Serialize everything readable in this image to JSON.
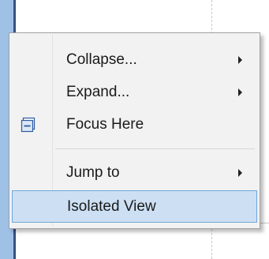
{
  "context_menu": {
    "items": [
      {
        "label": "Collapse...",
        "has_submenu": true,
        "icon": ""
      },
      {
        "label": "Expand...",
        "has_submenu": true,
        "icon": ""
      },
      {
        "label": "Focus Here",
        "has_submenu": false,
        "icon": "focus-frame-icon"
      },
      {
        "label": "Jump to",
        "has_submenu": true,
        "icon": ""
      },
      {
        "label": "Isolated View",
        "has_submenu": false,
        "icon": "",
        "highlighted": true
      }
    ]
  },
  "colors": {
    "menu_background": "#f2f2f2",
    "highlight_background": "#cde0f3",
    "highlight_border": "#6fa6dc",
    "left_bar": "#9fc1e6",
    "left_bar_edge": "#3a4f84",
    "icon_blue": "#2d5a9e"
  }
}
